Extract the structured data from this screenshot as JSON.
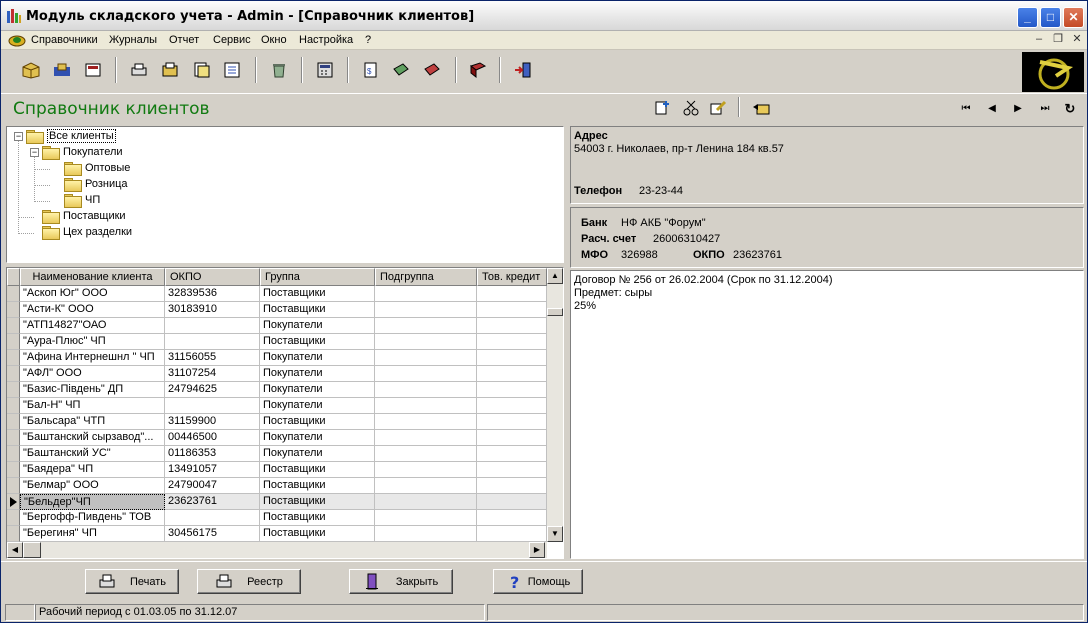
{
  "window": {
    "title": "Модуль складского учета - Admin - [Справочник клиентов]"
  },
  "menu": [
    "Справочники",
    "Журналы",
    "Отчет",
    "Сервис",
    "Окно",
    "Настройка",
    "?"
  ],
  "form": {
    "title": "Справочник клиентов"
  },
  "tree": {
    "root": "Все клиенты",
    "buyers": "Покупатели",
    "wholesale": "Оптовые",
    "retail": "Розница",
    "pe": "ЧП",
    "suppliers": "Поставщики",
    "workshop": "Цех разделки"
  },
  "grid": {
    "columns": [
      "Наименование клиента",
      "ОКПО",
      "Группа",
      "Подгруппа",
      "Тов. кредит"
    ],
    "rows": [
      [
        "\"Аскоп Юг\" ООО",
        "32839536",
        "Поставщики",
        "",
        ""
      ],
      [
        "\"Асти-К\" ООО",
        "30183910",
        "Поставщики",
        "",
        ""
      ],
      [
        "\"АТП14827\"ОАО",
        "",
        "Покупатели",
        "",
        ""
      ],
      [
        "\"Аура-Плюс\" ЧП",
        "",
        "Поставщики",
        "",
        ""
      ],
      [
        "\"Афина Интернешнл \" ЧП",
        "31156055",
        "Покупатели",
        "",
        ""
      ],
      [
        "\"АФЛ\" ООО",
        "31107254",
        "Покупатели",
        "",
        ""
      ],
      [
        "\"Базис-Південь\" ДП",
        "24794625",
        "Покупатели",
        "",
        ""
      ],
      [
        "\"Бал-Н\" ЧП",
        "",
        "Покупатели",
        "",
        ""
      ],
      [
        "\"Бальсара\" ЧТП",
        "31159900",
        "Поставщики",
        "",
        ""
      ],
      [
        "\"Баштанский сырзавод\"...",
        "00446500",
        "Покупатели",
        "",
        ""
      ],
      [
        "\"Баштанский УС\"",
        "01186353",
        "Покупатели",
        "",
        ""
      ],
      [
        "\"Баядера\" ЧП",
        "13491057",
        "Поставщики",
        "",
        ""
      ],
      [
        "\"Белмар\" ООО",
        "24790047",
        "Поставщики",
        "",
        ""
      ],
      [
        "\"Бельдер\"ЧП",
        "23623761",
        "Поставщики",
        "",
        ""
      ],
      [
        "\"Бергофф-Пивдень\" ТОВ",
        "",
        "Поставщики",
        "",
        ""
      ],
      [
        "\"Берегиня\" ЧП",
        "30456175",
        "Поставщики",
        "",
        ""
      ]
    ],
    "selected_index": 13
  },
  "details": {
    "address_label": "Адрес",
    "address": "54003 г. Николаев, пр-т Ленина 184 кв.57",
    "phone_label": "Телефон",
    "phone": "23-23-44",
    "bank_label": "Банк",
    "bank": "НФ АКБ \"Форум\"",
    "account_label": "Расч. счет",
    "account": "26006310427",
    "mfo_label": "МФО",
    "mfo": "326988",
    "okpo_label": "ОКПО",
    "okpo": "23623761",
    "notes": [
      "Договор № 256 от 26.02.2004 (Срок по 31.12.2004)",
      "Предмет: сыры",
      "25%"
    ]
  },
  "buttons": {
    "print": "Печать",
    "registry": "Реестр",
    "close": "Закрыть",
    "help": "Помощь"
  },
  "status": {
    "period": "Рабочий период с 01.03.05 по 31.12.07"
  },
  "colors": {
    "title_green": "#117a11",
    "title_bar_blue": "#2458c8"
  }
}
